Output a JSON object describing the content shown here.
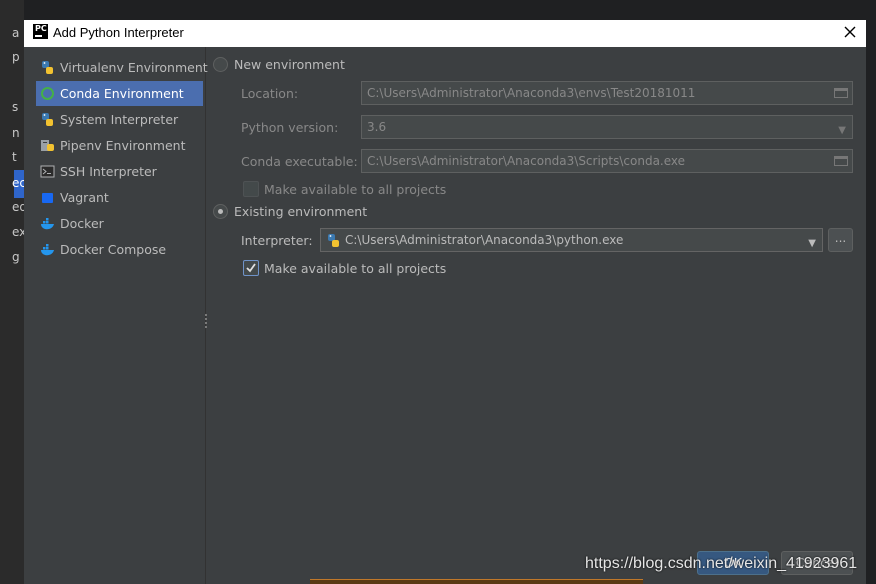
{
  "window": {
    "title": "Add Python Interpreter",
    "close_glyph": "✕"
  },
  "ide_background": {
    "chars": [
      "a",
      "p",
      "s",
      "n",
      "t",
      "ec",
      "ed",
      "ex",
      "g"
    ]
  },
  "sidebar": {
    "items": [
      {
        "label": "Virtualenv Environment",
        "icon": "python-icon",
        "selected": false
      },
      {
        "label": "Conda Environment",
        "icon": "conda-icon",
        "selected": true
      },
      {
        "label": "System Interpreter",
        "icon": "python-icon",
        "selected": false
      },
      {
        "label": "Pipenv Environment",
        "icon": "pipenv-icon",
        "selected": false
      },
      {
        "label": "SSH Interpreter",
        "icon": "terminal-icon",
        "selected": false
      },
      {
        "label": "Vagrant",
        "icon": "vagrant-icon",
        "selected": false
      },
      {
        "label": "Docker",
        "icon": "docker-icon",
        "selected": false
      },
      {
        "label": "Docker Compose",
        "icon": "docker-icon",
        "selected": false
      }
    ]
  },
  "new_env": {
    "radio_label": "New environment",
    "selected": false,
    "location_label": "Location:",
    "location_value": "C:\\Users\\Administrator\\Anaconda3\\envs\\Test20181011",
    "python_version_label": "Python version:",
    "python_version_value": "3.6",
    "conda_exe_label": "Conda executable:",
    "conda_exe_value": "C:\\Users\\Administrator\\Anaconda3\\Scripts\\conda.exe",
    "make_available_label": "Make available to all projects",
    "make_available_checked": false
  },
  "existing_env": {
    "radio_label": "Existing environment",
    "selected": true,
    "interpreter_label": "Interpreter:",
    "interpreter_value": "C:\\Users\\Administrator\\Anaconda3\\python.exe",
    "browse_label": "...",
    "make_available_label": "Make available to all projects",
    "make_available_checked": true
  },
  "buttons": {
    "ok": "OK",
    "cancel": "Cancel"
  },
  "watermark": "https://blog.csdn.net/weixin_41923961",
  "colors": {
    "accent": "#4b6eaf",
    "background": "#3c3f41",
    "ok_button": "#365880"
  }
}
